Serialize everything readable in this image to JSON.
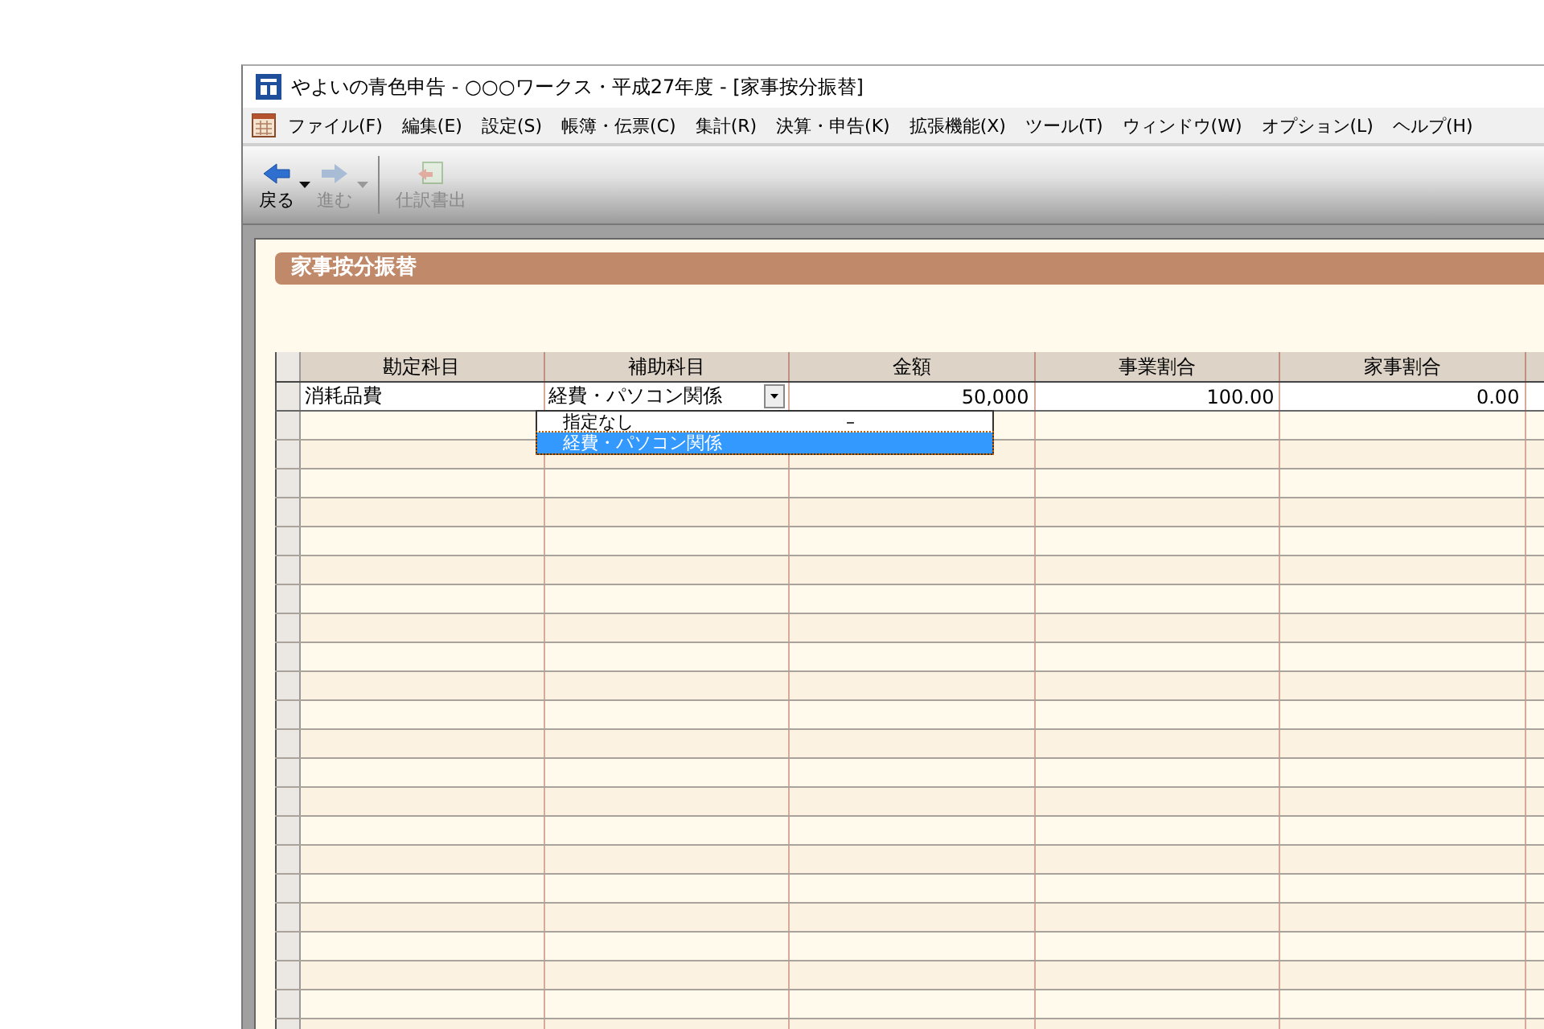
{
  "window": {
    "title": "やよいの青色申告 - ○○○ワークス・平成27年度 - [家事按分振替]"
  },
  "menu": [
    "ファイル(F)",
    "編集(E)",
    "設定(S)",
    "帳簿・伝票(C)",
    "集計(R)",
    "決算・申告(K)",
    "拡張機能(X)",
    "ツール(T)",
    "ウィンドウ(W)",
    "オプション(L)",
    "ヘルプ(H)"
  ],
  "toolbar": [
    {
      "kind": "back",
      "label": "戻る",
      "disabled": false,
      "dropdown": true
    },
    {
      "kind": "forward",
      "label": "進む",
      "disabled": true,
      "dropdown": true
    },
    {
      "kind": "export",
      "label": "仕訳書出",
      "disabled": true,
      "dropdown": false
    }
  ],
  "panel": {
    "title": "家事按分振替"
  },
  "table": {
    "columns": [
      "勘定科目",
      "補助科目",
      "金額",
      "事業割合",
      "家事割合"
    ],
    "rows": [
      {
        "cells": [
          "消耗品費",
          "経費・パソコン関係",
          "50,000",
          "100.00",
          "0.00"
        ]
      }
    ]
  },
  "dropdown": {
    "options": [
      {
        "label": "指定なし",
        "code": "–",
        "selected": false
      },
      {
        "label": "経費・パソコン関係",
        "selected": true
      }
    ]
  }
}
